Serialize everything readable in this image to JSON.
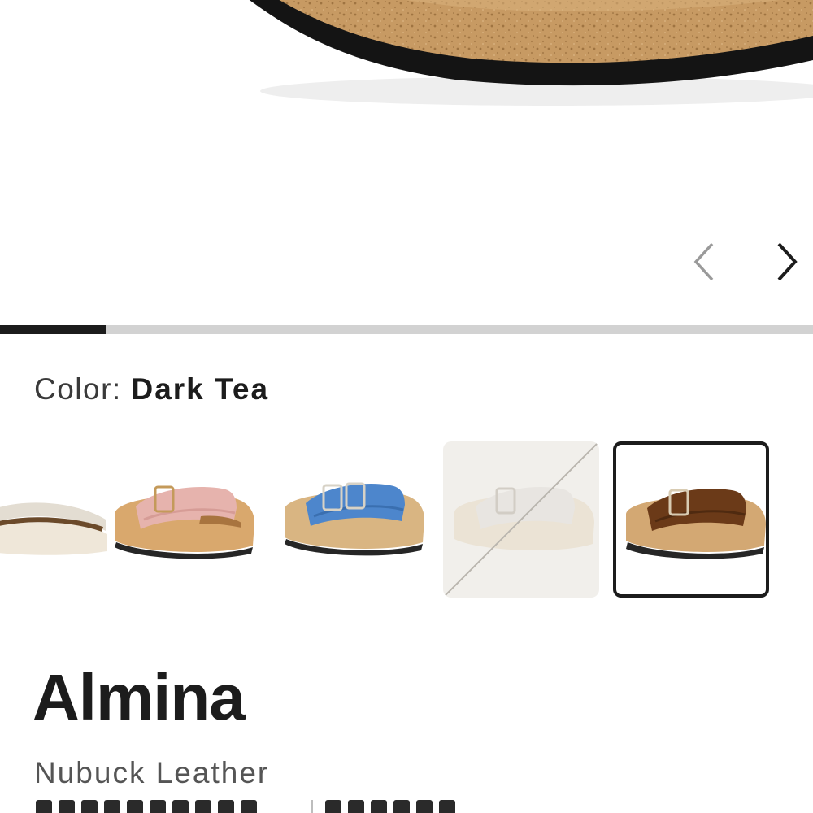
{
  "gallery": {
    "image_name": "product-hero-image",
    "prev_icon": "chevron-left-icon",
    "next_icon": "chevron-right-icon",
    "progress": 0.13,
    "colors": {
      "progress_fill": "#1c1c1c",
      "progress_track": "#d2d2d2"
    }
  },
  "color_selector": {
    "label": "Color:",
    "selected": "Dark Tea",
    "swatches": [
      {
        "name": "partially-visible",
        "strap": "#e3ddd2"
      },
      {
        "name": "pink",
        "strap": "#e6b3ad"
      },
      {
        "name": "blue",
        "strap": "#4d86cc"
      },
      {
        "name": "white",
        "strap": "#e8e5e1",
        "out_of_stock": true
      },
      {
        "name": "dark-tea",
        "strap": "#6b3a18",
        "selected": true
      }
    ]
  },
  "product": {
    "name": "Almina",
    "material": "Nubuck Leather"
  }
}
